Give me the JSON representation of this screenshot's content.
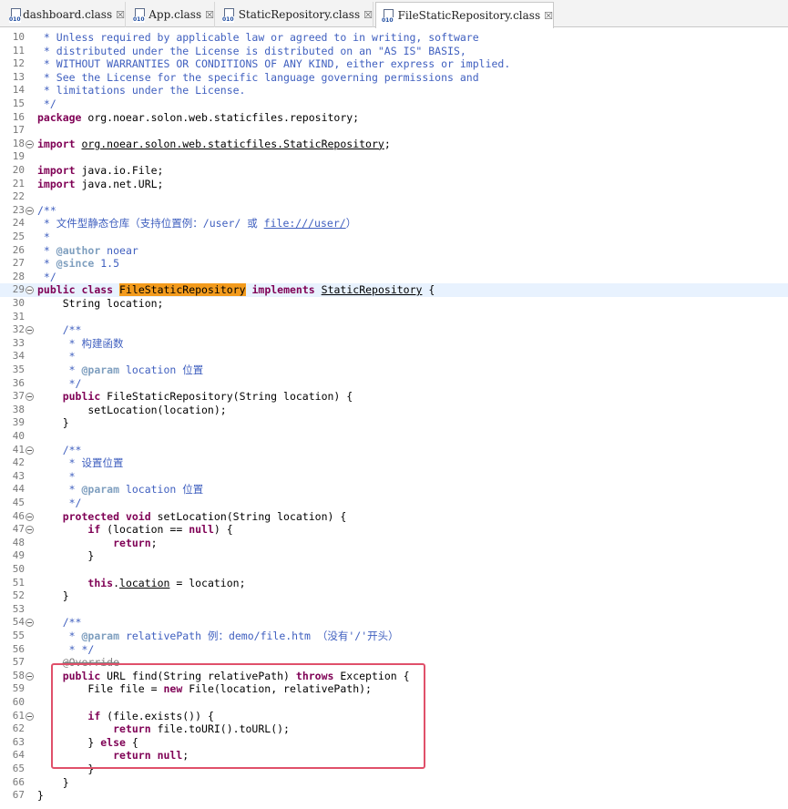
{
  "tabs": [
    {
      "label": "dashboard.class",
      "active": false
    },
    {
      "label": "App.class",
      "active": false
    },
    {
      "label": "StaticRepository.class",
      "active": false
    },
    {
      "label": "FileStaticRepository.class",
      "active": true
    }
  ],
  "close_glyph": "☒",
  "colors": {
    "keyword": "#7f0055",
    "comment": "#3f5fbf",
    "highlight": "#f39b1c",
    "annotation_box": "#e0506a"
  },
  "lines": [
    {
      "n": "10",
      "t": [
        {
          "s": " * Unless required by applicable law or agreed to in writing, software",
          "c": "cm"
        }
      ]
    },
    {
      "n": "11",
      "t": [
        {
          "s": " * distributed under the License is distributed on an \"AS IS\" BASIS,",
          "c": "cm"
        }
      ]
    },
    {
      "n": "12",
      "t": [
        {
          "s": " * WITHOUT WARRANTIES OR CONDITIONS OF ANY KIND, either express or implied.",
          "c": "cm"
        }
      ]
    },
    {
      "n": "13",
      "t": [
        {
          "s": " * See the License for the specific language governing permissions and",
          "c": "cm"
        }
      ]
    },
    {
      "n": "14",
      "t": [
        {
          "s": " * limitations under the License.",
          "c": "cm"
        }
      ]
    },
    {
      "n": "15",
      "t": [
        {
          "s": " */",
          "c": "cm"
        }
      ]
    },
    {
      "n": "16",
      "t": [
        {
          "s": "package",
          "c": "kw"
        },
        {
          "s": " org.noear.solon.web.staticfiles.repository;"
        }
      ]
    },
    {
      "n": "17",
      "t": []
    },
    {
      "n": "18",
      "fold": true,
      "t": [
        {
          "s": "import",
          "c": "kw"
        },
        {
          "s": " "
        },
        {
          "s": "org.noear.solon.web.staticfiles.StaticRepository",
          "c": "ul"
        },
        {
          "s": ";"
        }
      ]
    },
    {
      "n": "19",
      "t": []
    },
    {
      "n": "20",
      "t": [
        {
          "s": "import",
          "c": "kw"
        },
        {
          "s": " java.io.File;"
        }
      ]
    },
    {
      "n": "21",
      "t": [
        {
          "s": "import",
          "c": "kw"
        },
        {
          "s": " java.net.URL;"
        }
      ]
    },
    {
      "n": "22",
      "t": []
    },
    {
      "n": "23",
      "fold": true,
      "t": [
        {
          "s": "/**",
          "c": "cm"
        }
      ]
    },
    {
      "n": "24",
      "t": [
        {
          "s": " * 文件型静态仓库（支持位置例：/user/ 或 ",
          "c": "cm"
        },
        {
          "s": "file:///user/",
          "c": "cm ul"
        },
        {
          "s": "）",
          "c": "cm"
        }
      ]
    },
    {
      "n": "25",
      "t": [
        {
          "s": " *",
          "c": "cm"
        }
      ]
    },
    {
      "n": "26",
      "t": [
        {
          "s": " * ",
          "c": "cm"
        },
        {
          "s": "@author",
          "c": "tag"
        },
        {
          "s": " noear",
          "c": "cm"
        }
      ]
    },
    {
      "n": "27",
      "t": [
        {
          "s": " * ",
          "c": "cm"
        },
        {
          "s": "@since",
          "c": "tag"
        },
        {
          "s": " 1.5",
          "c": "cm"
        }
      ]
    },
    {
      "n": "28",
      "t": [
        {
          "s": " */",
          "c": "cm"
        }
      ]
    },
    {
      "n": "29",
      "fold": true,
      "cur": true,
      "t": [
        {
          "s": "public",
          "c": "kw"
        },
        {
          "s": " "
        },
        {
          "s": "class",
          "c": "kw"
        },
        {
          "s": " "
        },
        {
          "s": "FileStaticRepository",
          "c": "hl"
        },
        {
          "s": " "
        },
        {
          "s": "implements",
          "c": "kw"
        },
        {
          "s": " "
        },
        {
          "s": "StaticRepository",
          "c": "ul"
        },
        {
          "s": " {"
        }
      ]
    },
    {
      "n": "30",
      "t": [
        {
          "s": "    String location;"
        }
      ]
    },
    {
      "n": "31",
      "t": []
    },
    {
      "n": "32",
      "fold": true,
      "t": [
        {
          "s": "    /**",
          "c": "cm"
        }
      ]
    },
    {
      "n": "33",
      "t": [
        {
          "s": "     * 构建函数",
          "c": "cm"
        }
      ]
    },
    {
      "n": "34",
      "t": [
        {
          "s": "     *",
          "c": "cm"
        }
      ]
    },
    {
      "n": "35",
      "t": [
        {
          "s": "     * ",
          "c": "cm"
        },
        {
          "s": "@param",
          "c": "tag"
        },
        {
          "s": " location 位置",
          "c": "cm"
        }
      ]
    },
    {
      "n": "36",
      "t": [
        {
          "s": "     */",
          "c": "cm"
        }
      ]
    },
    {
      "n": "37",
      "fold": true,
      "t": [
        {
          "s": "    "
        },
        {
          "s": "public",
          "c": "kw"
        },
        {
          "s": " FileStaticRepository(String location) {"
        }
      ]
    },
    {
      "n": "38",
      "t": [
        {
          "s": "        setLocation(location);"
        }
      ]
    },
    {
      "n": "39",
      "t": [
        {
          "s": "    }"
        }
      ]
    },
    {
      "n": "40",
      "t": []
    },
    {
      "n": "41",
      "fold": true,
      "t": [
        {
          "s": "    /**",
          "c": "cm"
        }
      ]
    },
    {
      "n": "42",
      "t": [
        {
          "s": "     * 设置位置",
          "c": "cm"
        }
      ]
    },
    {
      "n": "43",
      "t": [
        {
          "s": "     *",
          "c": "cm"
        }
      ]
    },
    {
      "n": "44",
      "t": [
        {
          "s": "     * ",
          "c": "cm"
        },
        {
          "s": "@param",
          "c": "tag"
        },
        {
          "s": " location 位置",
          "c": "cm"
        }
      ]
    },
    {
      "n": "45",
      "t": [
        {
          "s": "     */",
          "c": "cm"
        }
      ]
    },
    {
      "n": "46",
      "fold": true,
      "t": [
        {
          "s": "    "
        },
        {
          "s": "protected",
          "c": "kw"
        },
        {
          "s": " "
        },
        {
          "s": "void",
          "c": "kw"
        },
        {
          "s": " setLocation(String location) {"
        }
      ]
    },
    {
      "n": "47",
      "fold": true,
      "t": [
        {
          "s": "        "
        },
        {
          "s": "if",
          "c": "kw"
        },
        {
          "s": " (location == "
        },
        {
          "s": "null",
          "c": "kw"
        },
        {
          "s": ") {"
        }
      ]
    },
    {
      "n": "48",
      "t": [
        {
          "s": "            "
        },
        {
          "s": "return",
          "c": "kw"
        },
        {
          "s": ";"
        }
      ]
    },
    {
      "n": "49",
      "t": [
        {
          "s": "        }"
        }
      ]
    },
    {
      "n": "50",
      "t": []
    },
    {
      "n": "51",
      "t": [
        {
          "s": "        "
        },
        {
          "s": "this",
          "c": "kw"
        },
        {
          "s": "."
        },
        {
          "s": "location",
          "c": "ul"
        },
        {
          "s": " = location;"
        }
      ]
    },
    {
      "n": "52",
      "t": [
        {
          "s": "    }"
        }
      ]
    },
    {
      "n": "53",
      "t": []
    },
    {
      "n": "54",
      "fold": true,
      "t": [
        {
          "s": "    /**",
          "c": "cm"
        }
      ]
    },
    {
      "n": "55",
      "t": [
        {
          "s": "     * ",
          "c": "cm"
        },
        {
          "s": "@param",
          "c": "tag"
        },
        {
          "s": " relativePath 例：demo/file.htm （没有'/'开头）",
          "c": "cm"
        }
      ]
    },
    {
      "n": "56",
      "t": [
        {
          "s": "     * */",
          "c": "cm"
        }
      ]
    },
    {
      "n": "57",
      "t": [
        {
          "s": "    "
        },
        {
          "s": "@Override",
          "c": "strike"
        }
      ]
    },
    {
      "n": "58",
      "fold": true,
      "t": [
        {
          "s": "    "
        },
        {
          "s": "public",
          "c": "kw"
        },
        {
          "s": " URL find(String relativePath) "
        },
        {
          "s": "throws",
          "c": "kw"
        },
        {
          "s": " Exception {"
        }
      ]
    },
    {
      "n": "59",
      "t": [
        {
          "s": "        File file = "
        },
        {
          "s": "new",
          "c": "kw"
        },
        {
          "s": " File(location, relativePath);"
        }
      ]
    },
    {
      "n": "60",
      "t": []
    },
    {
      "n": "61",
      "fold": true,
      "t": [
        {
          "s": "        "
        },
        {
          "s": "if",
          "c": "kw"
        },
        {
          "s": " (file.exists()) {"
        }
      ]
    },
    {
      "n": "62",
      "t": [
        {
          "s": "            "
        },
        {
          "s": "return",
          "c": "kw"
        },
        {
          "s": " file.toURI().toURL();"
        }
      ]
    },
    {
      "n": "63",
      "t": [
        {
          "s": "        } "
        },
        {
          "s": "else",
          "c": "kw"
        },
        {
          "s": " {"
        }
      ]
    },
    {
      "n": "64",
      "t": [
        {
          "s": "            "
        },
        {
          "s": "return",
          "c": "kw"
        },
        {
          "s": " "
        },
        {
          "s": "null",
          "c": "kw"
        },
        {
          "s": ";"
        }
      ]
    },
    {
      "n": "65",
      "t": [
        {
          "s": "        }"
        }
      ]
    },
    {
      "n": "66",
      "t": [
        {
          "s": "    }"
        }
      ]
    },
    {
      "n": "67",
      "t": [
        {
          "s": "}"
        }
      ]
    }
  ]
}
